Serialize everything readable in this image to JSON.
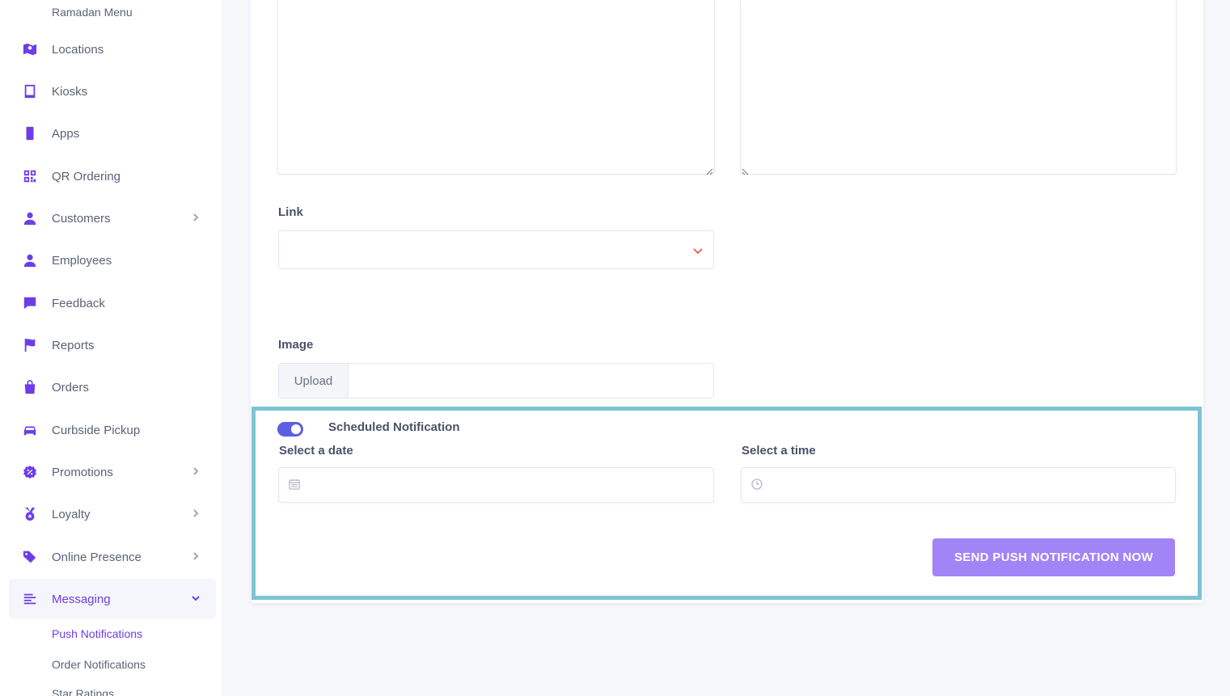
{
  "sidebar": {
    "top_sub_item": "Ramadan Menu",
    "items": [
      {
        "label": "Locations",
        "icon": "map-icon"
      },
      {
        "label": "Kiosks",
        "icon": "tablet-icon"
      },
      {
        "label": "Apps",
        "icon": "phone-icon"
      },
      {
        "label": "QR Ordering",
        "icon": "qr-code-icon"
      },
      {
        "label": "Customers",
        "icon": "user-icon"
      },
      {
        "label": "Employees",
        "icon": "user-icon"
      },
      {
        "label": "Feedback",
        "icon": "chat-bubble-icon"
      },
      {
        "label": "Reports",
        "icon": "flag-icon"
      },
      {
        "label": "Orders",
        "icon": "shopping-bag-icon"
      },
      {
        "label": "Curbside Pickup",
        "icon": "car-icon"
      },
      {
        "label": "Promotions",
        "icon": "percent-badge-icon"
      },
      {
        "label": "Loyalty",
        "icon": "medal-icon"
      },
      {
        "label": "Online Presence",
        "icon": "tags-icon"
      },
      {
        "label": "Messaging",
        "icon": "list-icon"
      }
    ],
    "sub_items": [
      "Push Notifications",
      "Order Notifications",
      "Star Ratings"
    ]
  },
  "form": {
    "link_label": "Link",
    "image_label": "Image",
    "upload_label": "Upload",
    "scheduled_label": "Scheduled Notification",
    "scheduled_enabled": true,
    "date_label": "Select a date",
    "time_label": "Select a time",
    "send_button": "SEND PUSH NOTIFICATION NOW"
  },
  "colors": {
    "accent": "#6d3ee8",
    "send_button_bg": "#a185f6",
    "toggle_on": "#5b5fe0",
    "highlight_border": "#7cc4d4"
  }
}
